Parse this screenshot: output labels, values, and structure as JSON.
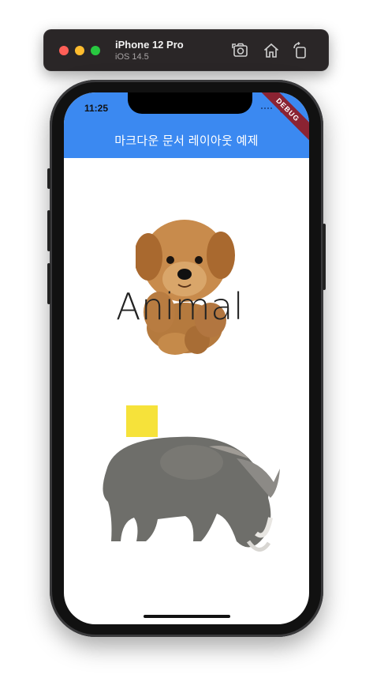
{
  "simulator": {
    "device_name": "iPhone 12 Pro",
    "os_version": "iOS 14.5",
    "icons": [
      "screenshot-icon",
      "home-icon",
      "rotate-icon"
    ]
  },
  "status_bar": {
    "time": "11:25"
  },
  "debug_banner": "DEBUG",
  "app_bar": {
    "title": "마크다운 문서 레이아웃 예제",
    "color": "#3b89f1"
  },
  "content": {
    "animal_label": "Animal",
    "images": [
      "puppy-image",
      "rhino-image"
    ],
    "overlay_square_color": "#f6e23a"
  }
}
